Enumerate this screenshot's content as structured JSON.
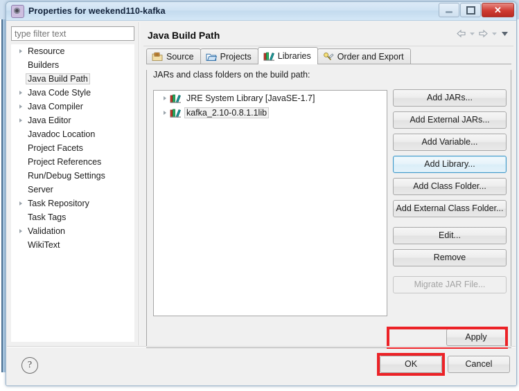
{
  "window": {
    "title": "Properties for weekend110-kafka",
    "icon": "properties-gear-icon",
    "buttons": {
      "minimize": "minimize-icon",
      "maximize": "maximize-icon",
      "close": "✕"
    }
  },
  "sidebar": {
    "filter": {
      "value": "",
      "placeholder": "type filter text"
    },
    "items": [
      {
        "label": "Resource",
        "expandable": true,
        "selected": false
      },
      {
        "label": "Builders",
        "expandable": false,
        "selected": false
      },
      {
        "label": "Java Build Path",
        "expandable": false,
        "selected": true
      },
      {
        "label": "Java Code Style",
        "expandable": true,
        "selected": false
      },
      {
        "label": "Java Compiler",
        "expandable": true,
        "selected": false
      },
      {
        "label": "Java Editor",
        "expandable": true,
        "selected": false
      },
      {
        "label": "Javadoc Location",
        "expandable": false,
        "selected": false
      },
      {
        "label": "Project Facets",
        "expandable": false,
        "selected": false
      },
      {
        "label": "Project References",
        "expandable": false,
        "selected": false
      },
      {
        "label": "Run/Debug Settings",
        "expandable": false,
        "selected": false
      },
      {
        "label": "Server",
        "expandable": false,
        "selected": false
      },
      {
        "label": "Task Repository",
        "expandable": true,
        "selected": false
      },
      {
        "label": "Task Tags",
        "expandable": false,
        "selected": false
      },
      {
        "label": "Validation",
        "expandable": true,
        "selected": false
      },
      {
        "label": "WikiText",
        "expandable": false,
        "selected": false
      }
    ]
  },
  "page": {
    "title": "Java Build Path",
    "nav": {
      "back": "back-arrow-icon",
      "back_menu": "chevron-down-icon",
      "forward": "forward-arrow-icon",
      "forward_menu": "chevron-down-icon",
      "view_menu": "chevron-down-icon"
    }
  },
  "tabs": [
    {
      "label": "Source",
      "icon": "source-folder-icon",
      "active": false
    },
    {
      "label": "Projects",
      "icon": "projects-folder-icon",
      "active": false
    },
    {
      "label": "Libraries",
      "icon": "libraries-books-icon",
      "active": true
    },
    {
      "label": "Order and Export",
      "icon": "order-export-icon",
      "active": false
    }
  ],
  "libraries_tab": {
    "list_label": "JARs and class folders on the build path:",
    "entries": [
      {
        "label": "JRE System Library [JavaSE-1.7]",
        "icon": "library-icon",
        "expandable": true,
        "selected": false
      },
      {
        "label": "kafka_2.10-0.8.1.1lib",
        "icon": "library-icon",
        "expandable": true,
        "selected": true
      }
    ],
    "buttons": [
      {
        "label": "Add JARs...",
        "state": "normal"
      },
      {
        "label": "Add External JARs...",
        "state": "normal"
      },
      {
        "label": "Add Variable...",
        "state": "normal"
      },
      {
        "label": "Add Library...",
        "state": "focused"
      },
      {
        "label": "Add Class Folder...",
        "state": "normal"
      },
      {
        "label": "Add External Class Folder...",
        "state": "normal"
      },
      {
        "label": "Edit...",
        "state": "normal"
      },
      {
        "label": "Remove",
        "state": "normal"
      },
      {
        "label": "Migrate JAR File...",
        "state": "disabled"
      }
    ],
    "apply_label": "Apply"
  },
  "footer": {
    "help": "?",
    "ok_label": "OK",
    "cancel_label": "Cancel"
  },
  "annotations": {
    "highlight_color": "#ec2227",
    "highlighted": [
      "Apply",
      "OK"
    ]
  }
}
